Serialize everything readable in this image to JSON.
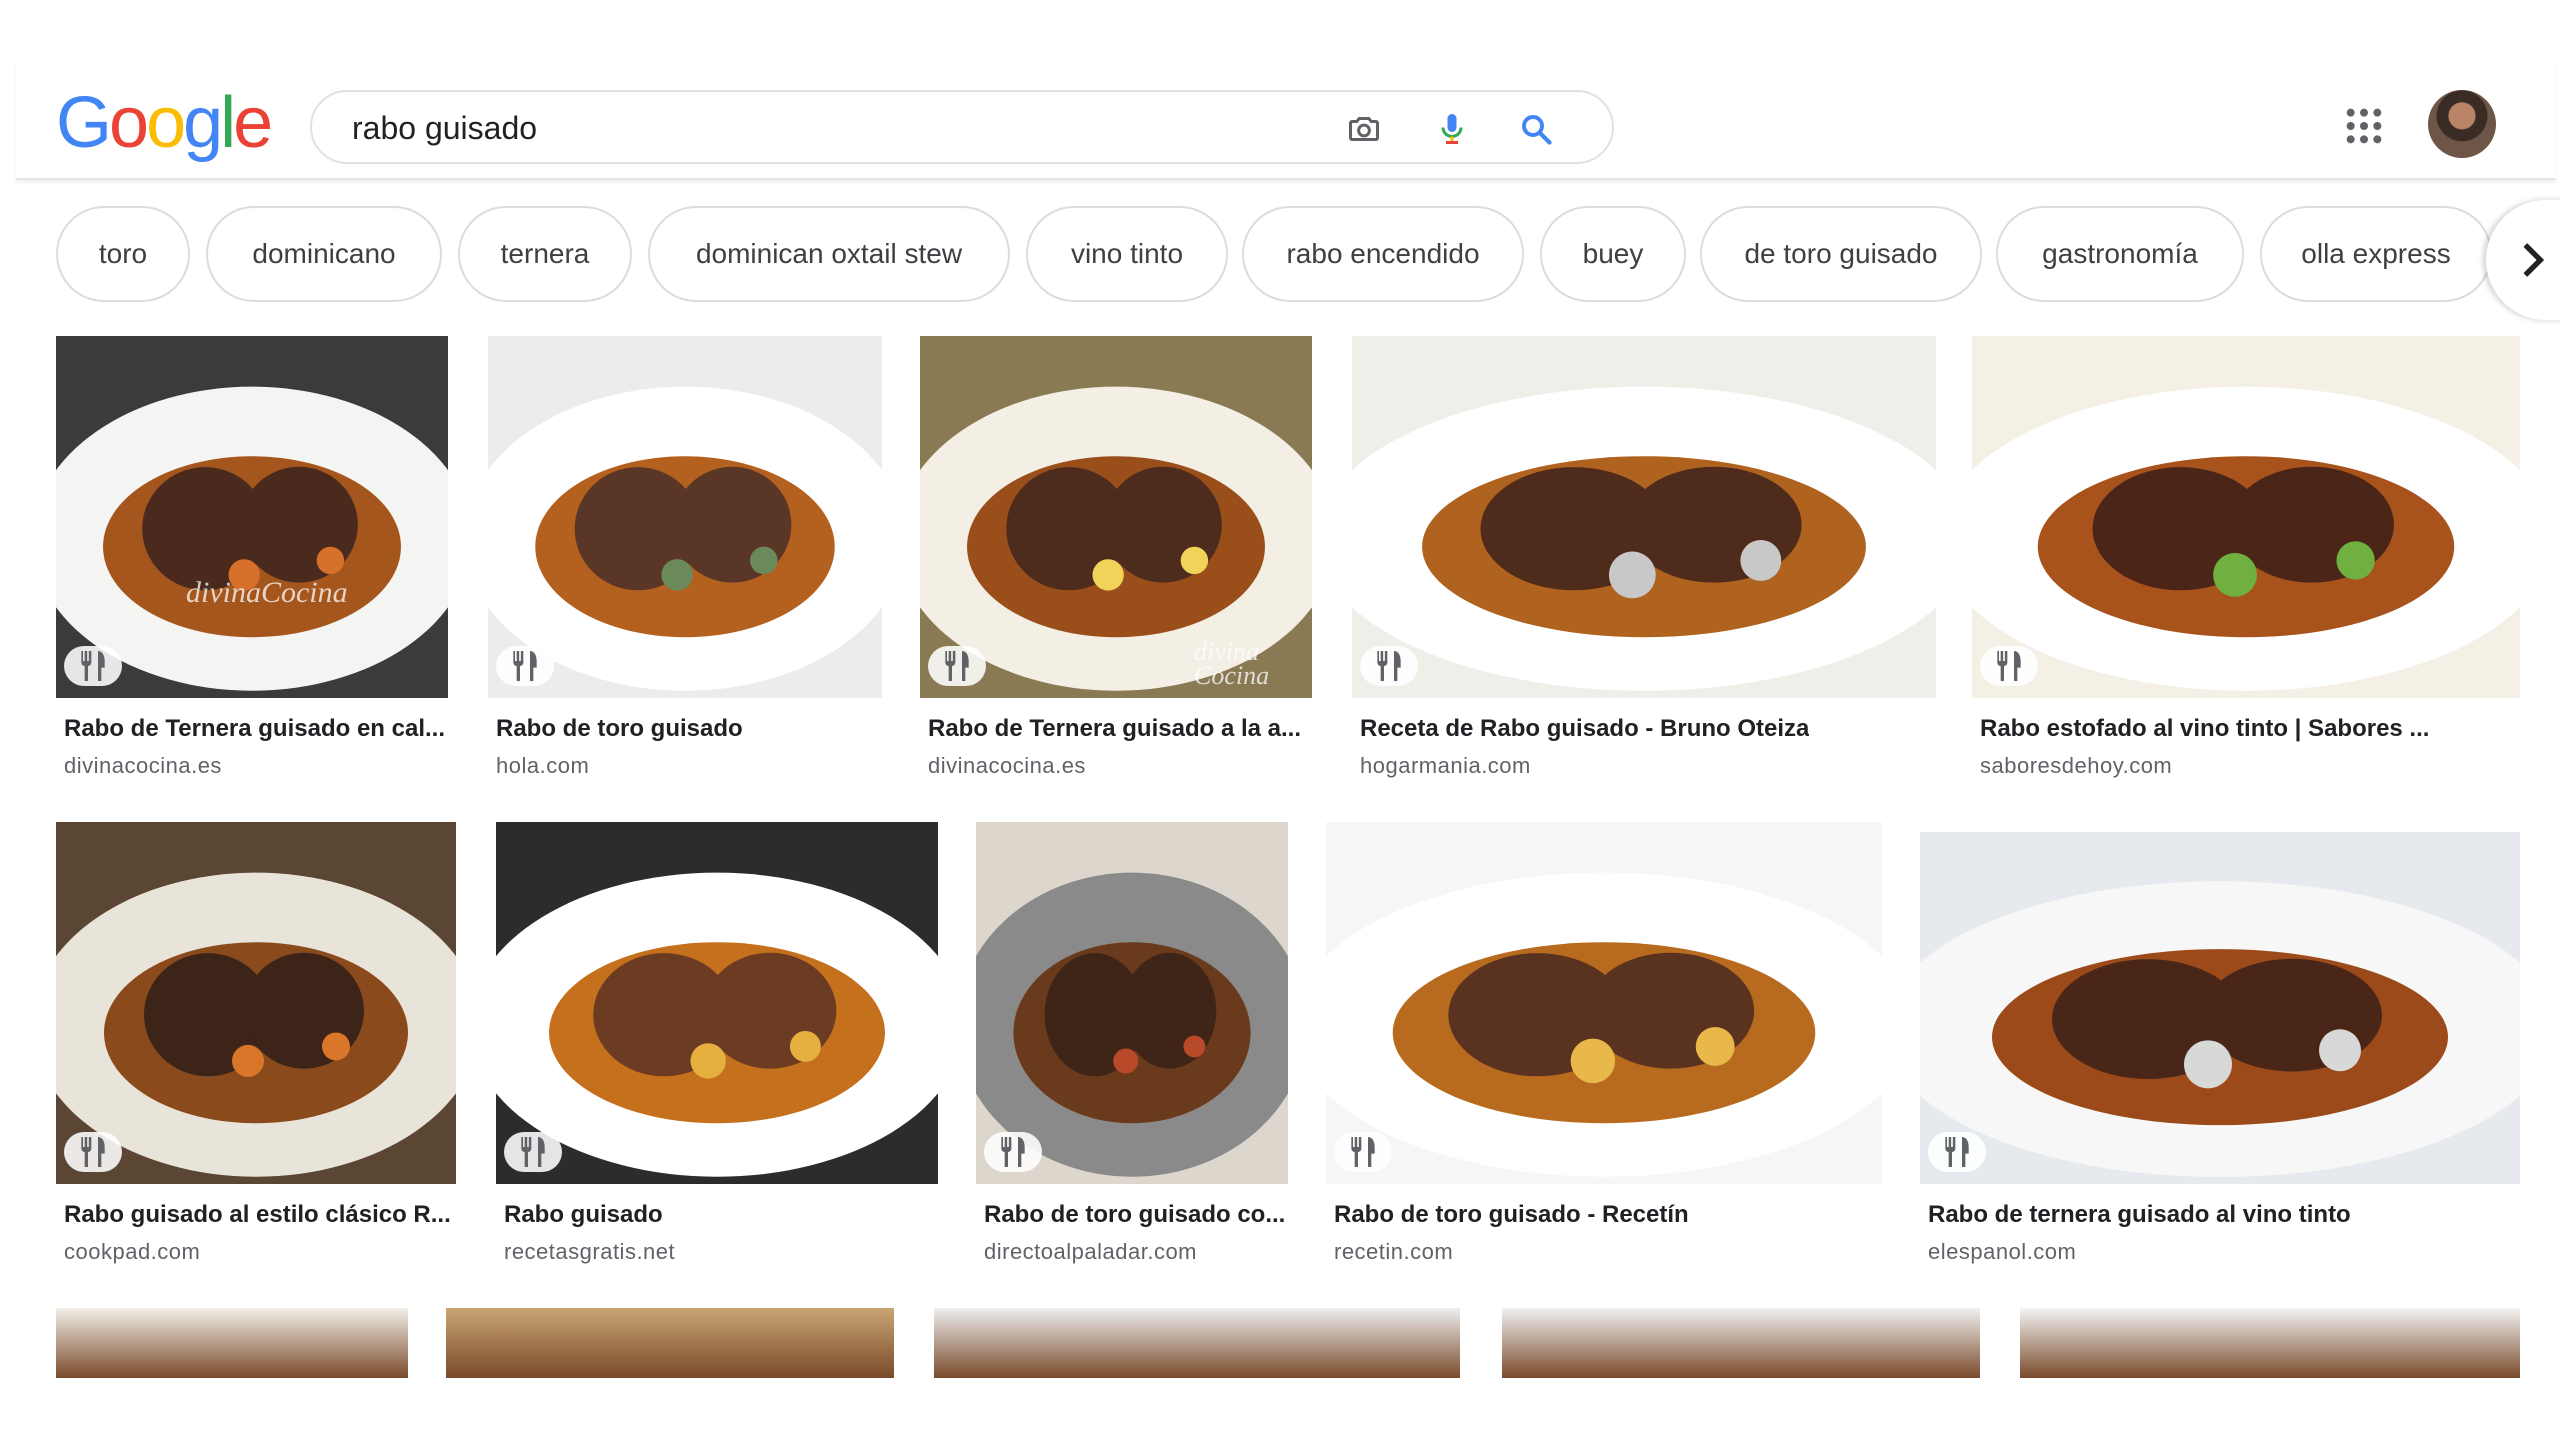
{
  "header": {
    "logo_letters": [
      {
        "ch": "G",
        "color": "#4285F4"
      },
      {
        "ch": "o",
        "color": "#EA4335"
      },
      {
        "ch": "o",
        "color": "#FBBC05"
      },
      {
        "ch": "g",
        "color": "#4285F4"
      },
      {
        "ch": "l",
        "color": "#34A853"
      },
      {
        "ch": "e",
        "color": "#EA4335"
      }
    ],
    "search_query": "rabo guisado",
    "icons": [
      "camera-icon",
      "microphone-icon",
      "search-icon",
      "apps-grid-icon",
      "avatar"
    ]
  },
  "chips": [
    "toro",
    "dominicano",
    "ternera",
    "dominican oxtail stew",
    "vino tinto",
    "rabo encendido",
    "buey",
    "de toro guisado",
    "gastronomía",
    "olla express"
  ],
  "results": [
    {
      "title": "Rabo de Ternera guisado en cal...",
      "site": "divinacocina.es",
      "watermark": "divinaCocina"
    },
    {
      "title": "Rabo de toro guisado",
      "site": "hola.com"
    },
    {
      "title": "Rabo de Ternera guisado a la a...",
      "site": "divinacocina.es",
      "watermark": "divina Cocina"
    },
    {
      "title": "Receta de Rabo guisado - Bruno Oteiza",
      "site": "hogarmania.com"
    },
    {
      "title": "Rabo estofado al vino tinto | Sabores ...",
      "site": "saboresdehoy.com"
    },
    {
      "title": "Rabo guisado al estilo clásico R...",
      "site": "cookpad.com"
    },
    {
      "title": "Rabo guisado",
      "site": "recetasgratis.net"
    },
    {
      "title": "Rabo de toro guisado co...",
      "site": "directoalpaladar.com"
    },
    {
      "title": "Rabo de toro guisado - Recetín",
      "site": "recetin.com"
    },
    {
      "title": "Rabo de ternera guisado al vino tinto",
      "site": "elespanol.com"
    }
  ],
  "colors": {
    "accent_blue": "#4285F4",
    "text_primary": "#202124",
    "text_secondary": "#5f6368",
    "chip_border": "#dadce0"
  }
}
